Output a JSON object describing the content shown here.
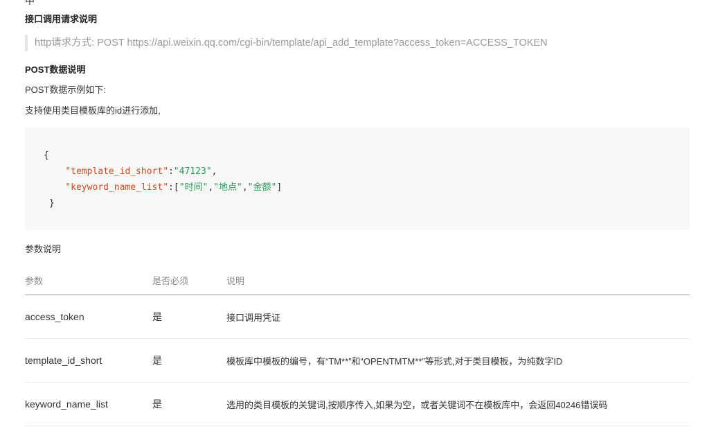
{
  "top_fragment": "中",
  "api_section": {
    "heading": "接口调用请求说明",
    "http_request": "http请求方式: POST https://api.weixin.qq.com/cgi-bin/template/api_add_template?access_token=ACCESS_TOKEN"
  },
  "post_section": {
    "heading": "POST数据说明",
    "intro": "POST数据示例如下:",
    "note": "支持使用类目模板库的id进行添加,",
    "code": {
      "open_brace": "{",
      "line1_key": "\"template_id_short\"",
      "line1_colon": ":",
      "line1_value": "\"47123\"",
      "line1_comma": ",",
      "line2_key": "\"keyword_name_list\"",
      "line2_colon": ":[",
      "line2_v1": "\"时间\"",
      "line2_sep1": ",",
      "line2_v2": "\"地点\"",
      "line2_sep2": ",",
      "line2_v3": "\"金额\"",
      "line2_close": "]",
      "close_brace": " }"
    }
  },
  "params_section": {
    "heading": "参数说明",
    "columns": [
      "参数",
      "是否必须",
      "说明"
    ],
    "rows": [
      {
        "param": "access_token",
        "required": "是",
        "desc": "接口调用凭证"
      },
      {
        "param": "template_id_short",
        "required": "是",
        "desc": "模板库中模板的编号，有“TM**”和“OPENTMTM**”等形式,对于类目模板，为纯数字ID"
      },
      {
        "param": "keyword_name_list",
        "required": "是",
        "desc": "选用的类目模板的关键词,按顺序传入,如果为空，或者关键词不在模板库中，会返回40246错误码"
      }
    ]
  },
  "colors": {
    "code_key": "#d14d1a",
    "code_string": "#22a055",
    "code_background": "#f7f7f7",
    "quote_text": "#9a9a9a"
  }
}
